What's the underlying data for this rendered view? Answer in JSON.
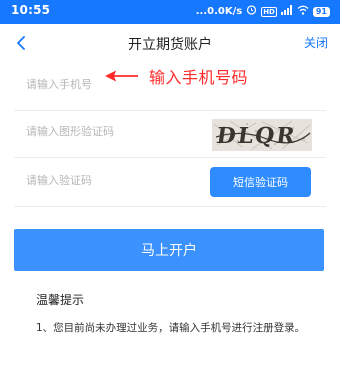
{
  "status_bar": {
    "time": "10:55",
    "network_speed": "...0.0K/s",
    "battery": "91",
    "icons": [
      "alarm-icon",
      "hd-icon",
      "signal-icon",
      "wifi-icon",
      "battery-icon"
    ]
  },
  "nav": {
    "title": "开立期货账户",
    "close_label": "关闭"
  },
  "form": {
    "phone_placeholder": "请输入手机号",
    "captcha_placeholder": "请输入图形验证码",
    "captcha_image_text": "DLQR",
    "sms_code_placeholder": "请输入验证码",
    "sms_button_label": "短信验证码"
  },
  "annotation": {
    "text": "输入手机号码",
    "color": "#ff2a2a"
  },
  "submit": {
    "label": "马上开户"
  },
  "tips": {
    "title": "温馨提示",
    "items": [
      "1、您目前尚未办理过业务，请输入手机号进行注册登录。"
    ]
  },
  "colors": {
    "status_bar": "#1677ff",
    "accent": "#1677ff",
    "primary_button": "#3b92ff",
    "sms_button": "#2f8cff"
  }
}
